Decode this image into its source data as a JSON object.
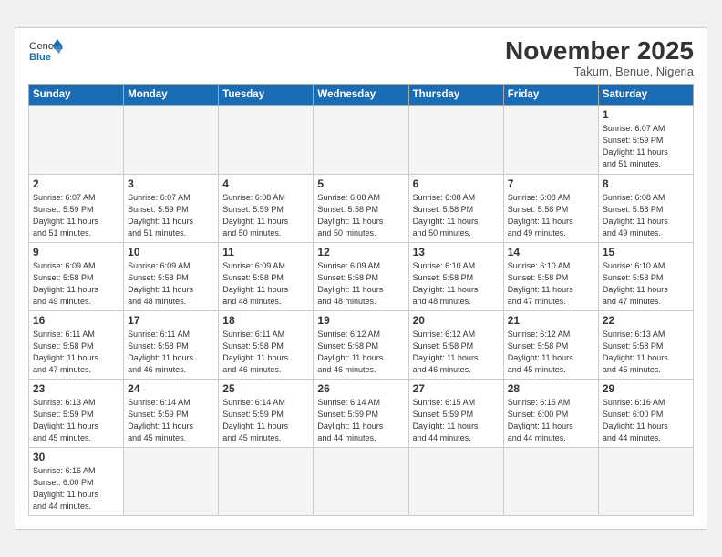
{
  "header": {
    "logo_general": "General",
    "logo_blue": "Blue",
    "month_title": "November 2025",
    "location": "Takum, Benue, Nigeria"
  },
  "weekdays": [
    "Sunday",
    "Monday",
    "Tuesday",
    "Wednesday",
    "Thursday",
    "Friday",
    "Saturday"
  ],
  "weeks": [
    [
      {
        "day": "",
        "info": ""
      },
      {
        "day": "",
        "info": ""
      },
      {
        "day": "",
        "info": ""
      },
      {
        "day": "",
        "info": ""
      },
      {
        "day": "",
        "info": ""
      },
      {
        "day": "",
        "info": ""
      },
      {
        "day": "1",
        "info": "Sunrise: 6:07 AM\nSunset: 5:59 PM\nDaylight: 11 hours\nand 51 minutes."
      }
    ],
    [
      {
        "day": "2",
        "info": "Sunrise: 6:07 AM\nSunset: 5:59 PM\nDaylight: 11 hours\nand 51 minutes."
      },
      {
        "day": "3",
        "info": "Sunrise: 6:07 AM\nSunset: 5:59 PM\nDaylight: 11 hours\nand 51 minutes."
      },
      {
        "day": "4",
        "info": "Sunrise: 6:08 AM\nSunset: 5:59 PM\nDaylight: 11 hours\nand 50 minutes."
      },
      {
        "day": "5",
        "info": "Sunrise: 6:08 AM\nSunset: 5:58 PM\nDaylight: 11 hours\nand 50 minutes."
      },
      {
        "day": "6",
        "info": "Sunrise: 6:08 AM\nSunset: 5:58 PM\nDaylight: 11 hours\nand 50 minutes."
      },
      {
        "day": "7",
        "info": "Sunrise: 6:08 AM\nSunset: 5:58 PM\nDaylight: 11 hours\nand 49 minutes."
      },
      {
        "day": "8",
        "info": "Sunrise: 6:08 AM\nSunset: 5:58 PM\nDaylight: 11 hours\nand 49 minutes."
      }
    ],
    [
      {
        "day": "9",
        "info": "Sunrise: 6:09 AM\nSunset: 5:58 PM\nDaylight: 11 hours\nand 49 minutes."
      },
      {
        "day": "10",
        "info": "Sunrise: 6:09 AM\nSunset: 5:58 PM\nDaylight: 11 hours\nand 48 minutes."
      },
      {
        "day": "11",
        "info": "Sunrise: 6:09 AM\nSunset: 5:58 PM\nDaylight: 11 hours\nand 48 minutes."
      },
      {
        "day": "12",
        "info": "Sunrise: 6:09 AM\nSunset: 5:58 PM\nDaylight: 11 hours\nand 48 minutes."
      },
      {
        "day": "13",
        "info": "Sunrise: 6:10 AM\nSunset: 5:58 PM\nDaylight: 11 hours\nand 48 minutes."
      },
      {
        "day": "14",
        "info": "Sunrise: 6:10 AM\nSunset: 5:58 PM\nDaylight: 11 hours\nand 47 minutes."
      },
      {
        "day": "15",
        "info": "Sunrise: 6:10 AM\nSunset: 5:58 PM\nDaylight: 11 hours\nand 47 minutes."
      }
    ],
    [
      {
        "day": "16",
        "info": "Sunrise: 6:11 AM\nSunset: 5:58 PM\nDaylight: 11 hours\nand 47 minutes."
      },
      {
        "day": "17",
        "info": "Sunrise: 6:11 AM\nSunset: 5:58 PM\nDaylight: 11 hours\nand 46 minutes."
      },
      {
        "day": "18",
        "info": "Sunrise: 6:11 AM\nSunset: 5:58 PM\nDaylight: 11 hours\nand 46 minutes."
      },
      {
        "day": "19",
        "info": "Sunrise: 6:12 AM\nSunset: 5:58 PM\nDaylight: 11 hours\nand 46 minutes."
      },
      {
        "day": "20",
        "info": "Sunrise: 6:12 AM\nSunset: 5:58 PM\nDaylight: 11 hours\nand 46 minutes."
      },
      {
        "day": "21",
        "info": "Sunrise: 6:12 AM\nSunset: 5:58 PM\nDaylight: 11 hours\nand 45 minutes."
      },
      {
        "day": "22",
        "info": "Sunrise: 6:13 AM\nSunset: 5:58 PM\nDaylight: 11 hours\nand 45 minutes."
      }
    ],
    [
      {
        "day": "23",
        "info": "Sunrise: 6:13 AM\nSunset: 5:59 PM\nDaylight: 11 hours\nand 45 minutes."
      },
      {
        "day": "24",
        "info": "Sunrise: 6:14 AM\nSunset: 5:59 PM\nDaylight: 11 hours\nand 45 minutes."
      },
      {
        "day": "25",
        "info": "Sunrise: 6:14 AM\nSunset: 5:59 PM\nDaylight: 11 hours\nand 45 minutes."
      },
      {
        "day": "26",
        "info": "Sunrise: 6:14 AM\nSunset: 5:59 PM\nDaylight: 11 hours\nand 44 minutes."
      },
      {
        "day": "27",
        "info": "Sunrise: 6:15 AM\nSunset: 5:59 PM\nDaylight: 11 hours\nand 44 minutes."
      },
      {
        "day": "28",
        "info": "Sunrise: 6:15 AM\nSunset: 6:00 PM\nDaylight: 11 hours\nand 44 minutes."
      },
      {
        "day": "29",
        "info": "Sunrise: 6:16 AM\nSunset: 6:00 PM\nDaylight: 11 hours\nand 44 minutes."
      }
    ],
    [
      {
        "day": "30",
        "info": "Sunrise: 6:16 AM\nSunset: 6:00 PM\nDaylight: 11 hours\nand 44 minutes."
      },
      {
        "day": "",
        "info": ""
      },
      {
        "day": "",
        "info": ""
      },
      {
        "day": "",
        "info": ""
      },
      {
        "day": "",
        "info": ""
      },
      {
        "day": "",
        "info": ""
      },
      {
        "day": "",
        "info": ""
      }
    ]
  ]
}
